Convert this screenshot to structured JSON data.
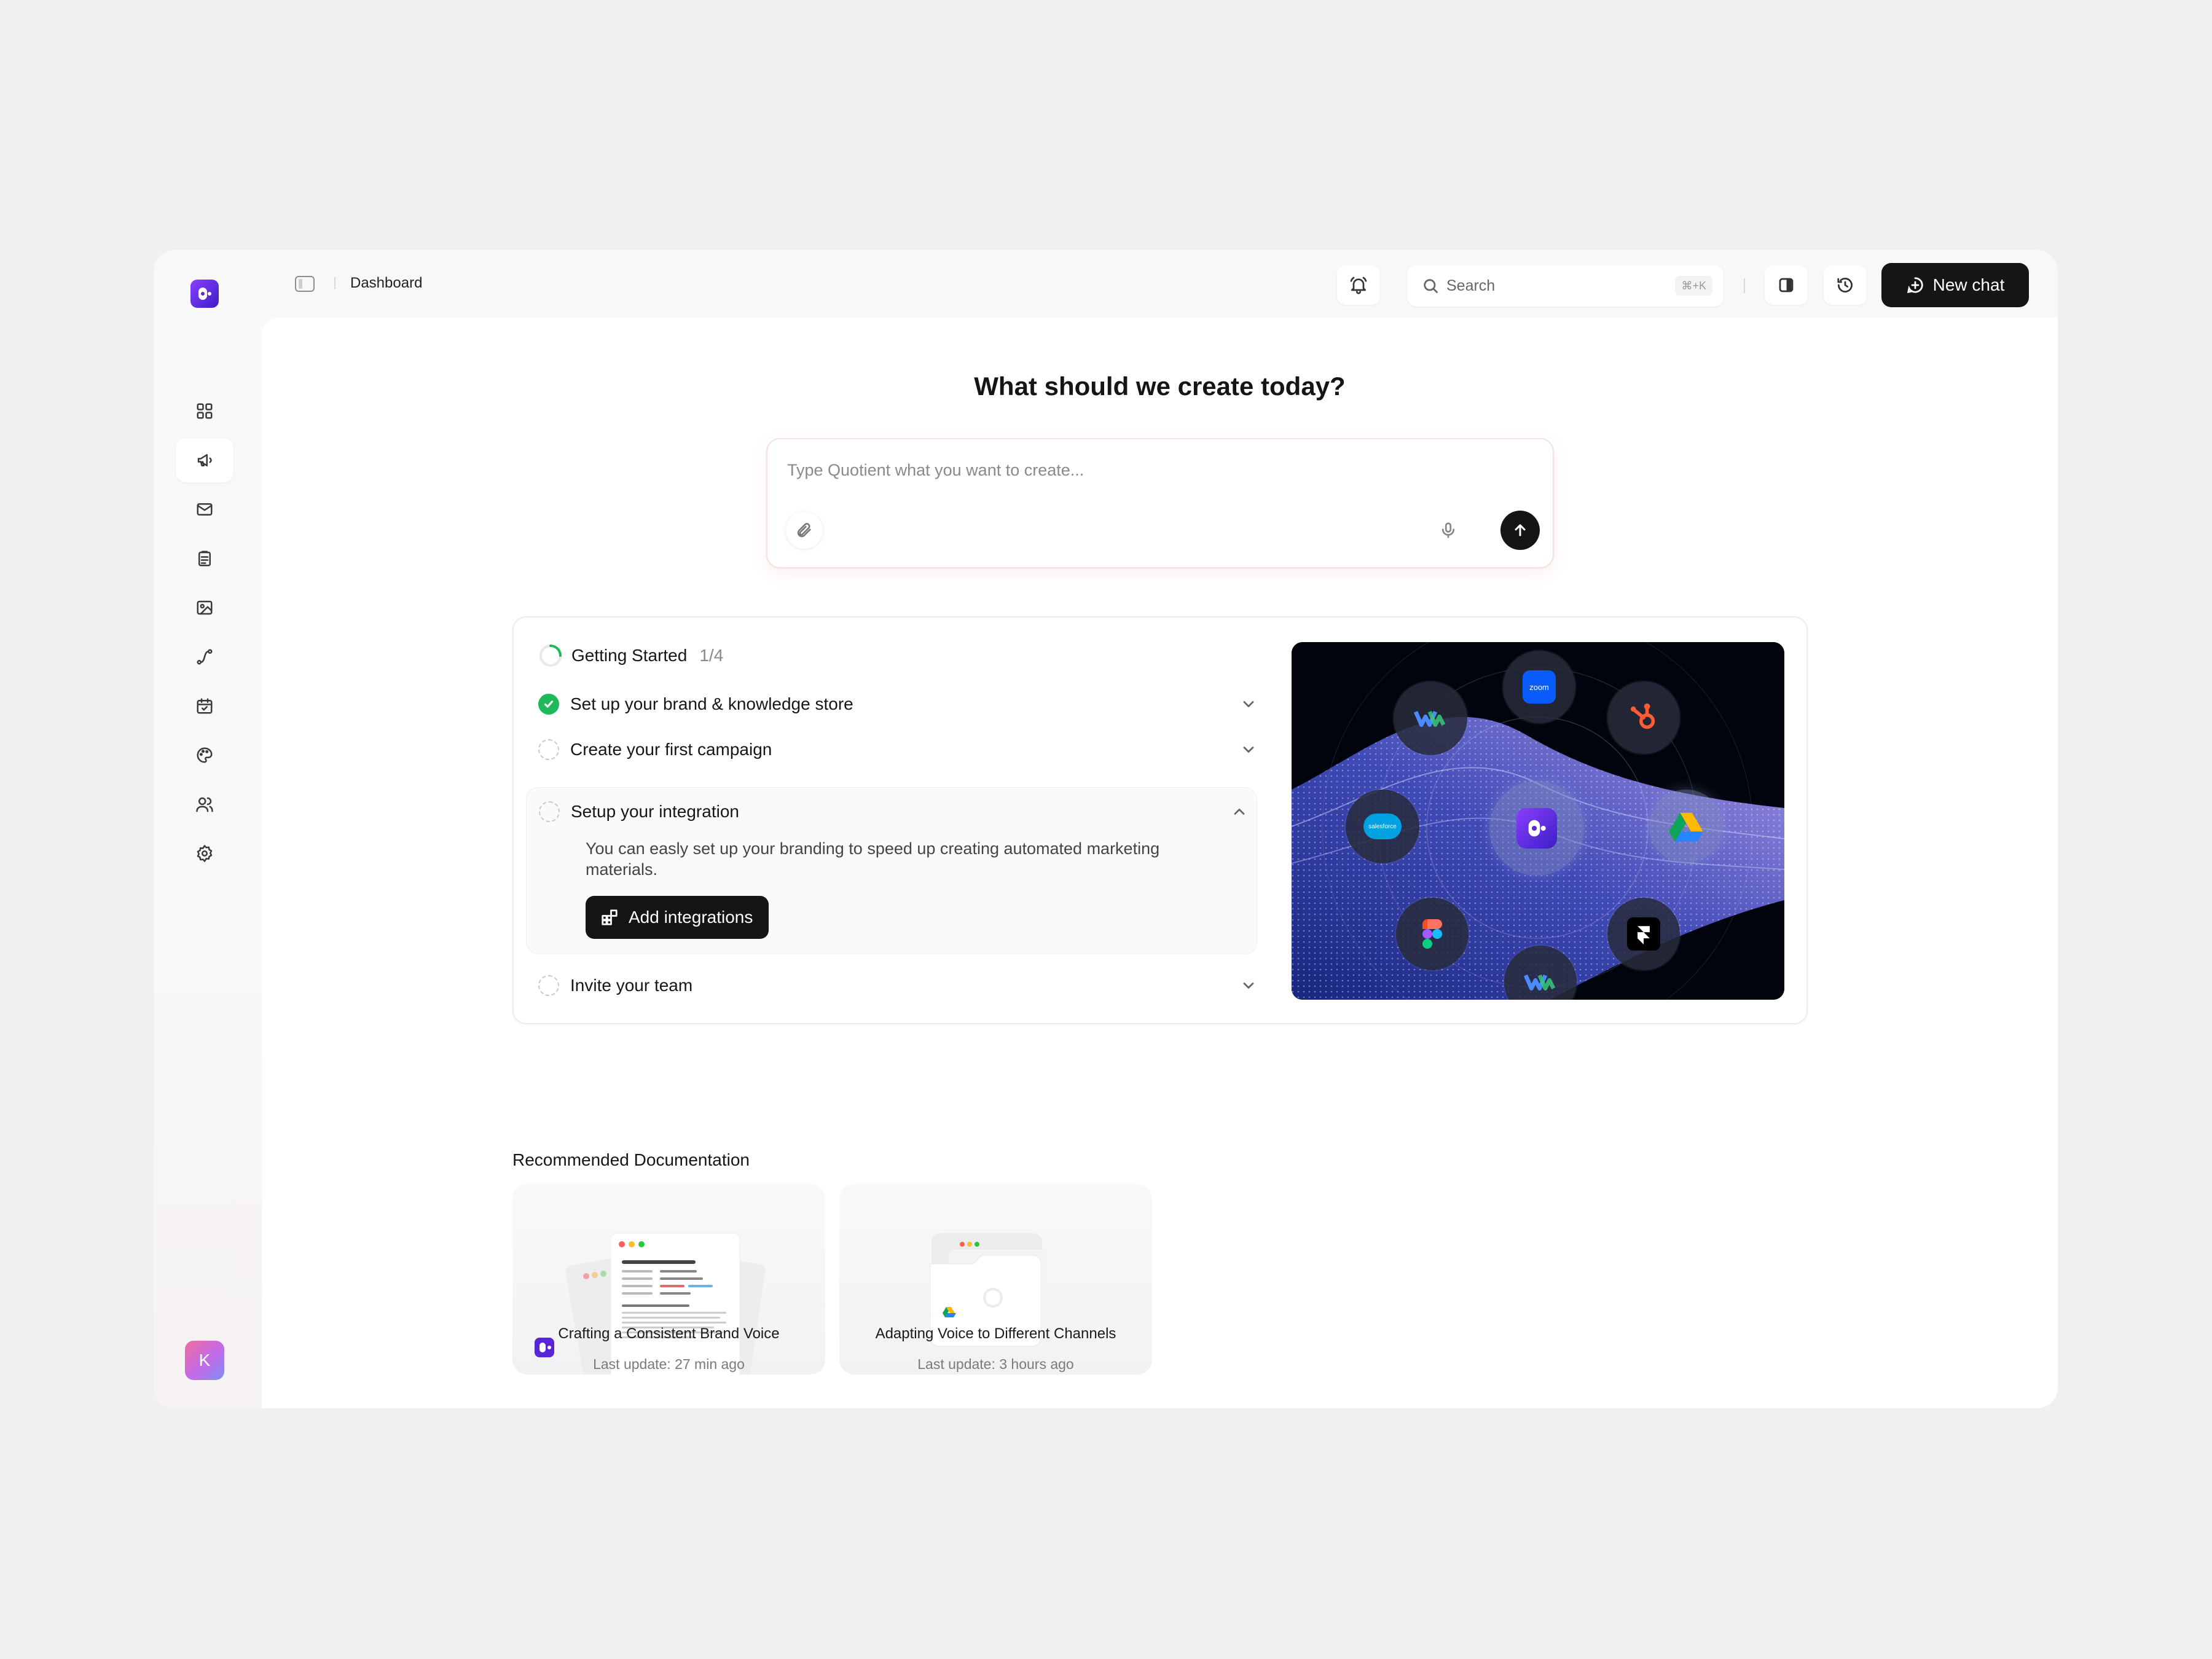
{
  "app": {
    "avatar_initial": "K"
  },
  "topbar": {
    "breadcrumb": "Dashboard",
    "search_placeholder": "Search",
    "search_shortcut": "⌘+K",
    "new_chat_label": "New chat"
  },
  "sidebar": {
    "items": [
      {
        "icon": "dashboard-icon",
        "active": false
      },
      {
        "icon": "megaphone-icon",
        "active": true
      },
      {
        "icon": "mail-icon",
        "active": false
      },
      {
        "icon": "clipboard-icon",
        "active": false
      },
      {
        "icon": "image-icon",
        "active": false
      },
      {
        "icon": "route-icon",
        "active": false
      },
      {
        "icon": "calendar-icon",
        "active": false
      },
      {
        "icon": "palette-icon",
        "active": false
      },
      {
        "icon": "users-icon",
        "active": false
      },
      {
        "icon": "settings-icon",
        "active": false
      }
    ]
  },
  "main": {
    "headline": "What should we create today?",
    "prompt_placeholder": "Type Quotient what you want to create..."
  },
  "getting_started": {
    "title": "Getting Started",
    "progress": "1/4",
    "progress_fraction": 0.25,
    "steps": [
      {
        "label": "Set up your brand & knowledge store",
        "done": true
      },
      {
        "label": "Create your first campaign",
        "done": false
      },
      {
        "label": "Setup your integration",
        "done": false,
        "expanded": true,
        "description": "You can easly set up your branding to speed up creating automated marketing materials.",
        "action_label": "Add integrations"
      },
      {
        "label": "Invite your team",
        "done": false
      }
    ],
    "integration_logos": [
      "zoom",
      "hubspot",
      "google-drive",
      "framer",
      "webflow",
      "figma",
      "salesforce",
      "webflow",
      "quotient"
    ],
    "zoom_label": "zoom",
    "salesforce_label": "salesforce"
  },
  "docs": {
    "title": "Recommended Documentation",
    "items": [
      {
        "name": "Crafting a Consistent Brand Voice",
        "meta": "Last update: 27 min ago"
      },
      {
        "name": "Adapting Voice to Different Channels",
        "meta": "Last update: 3 hours ago"
      }
    ]
  },
  "colors": {
    "accent_dark": "#151515",
    "success": "#1fb85a",
    "brand_purple": "#6a2cf0"
  }
}
